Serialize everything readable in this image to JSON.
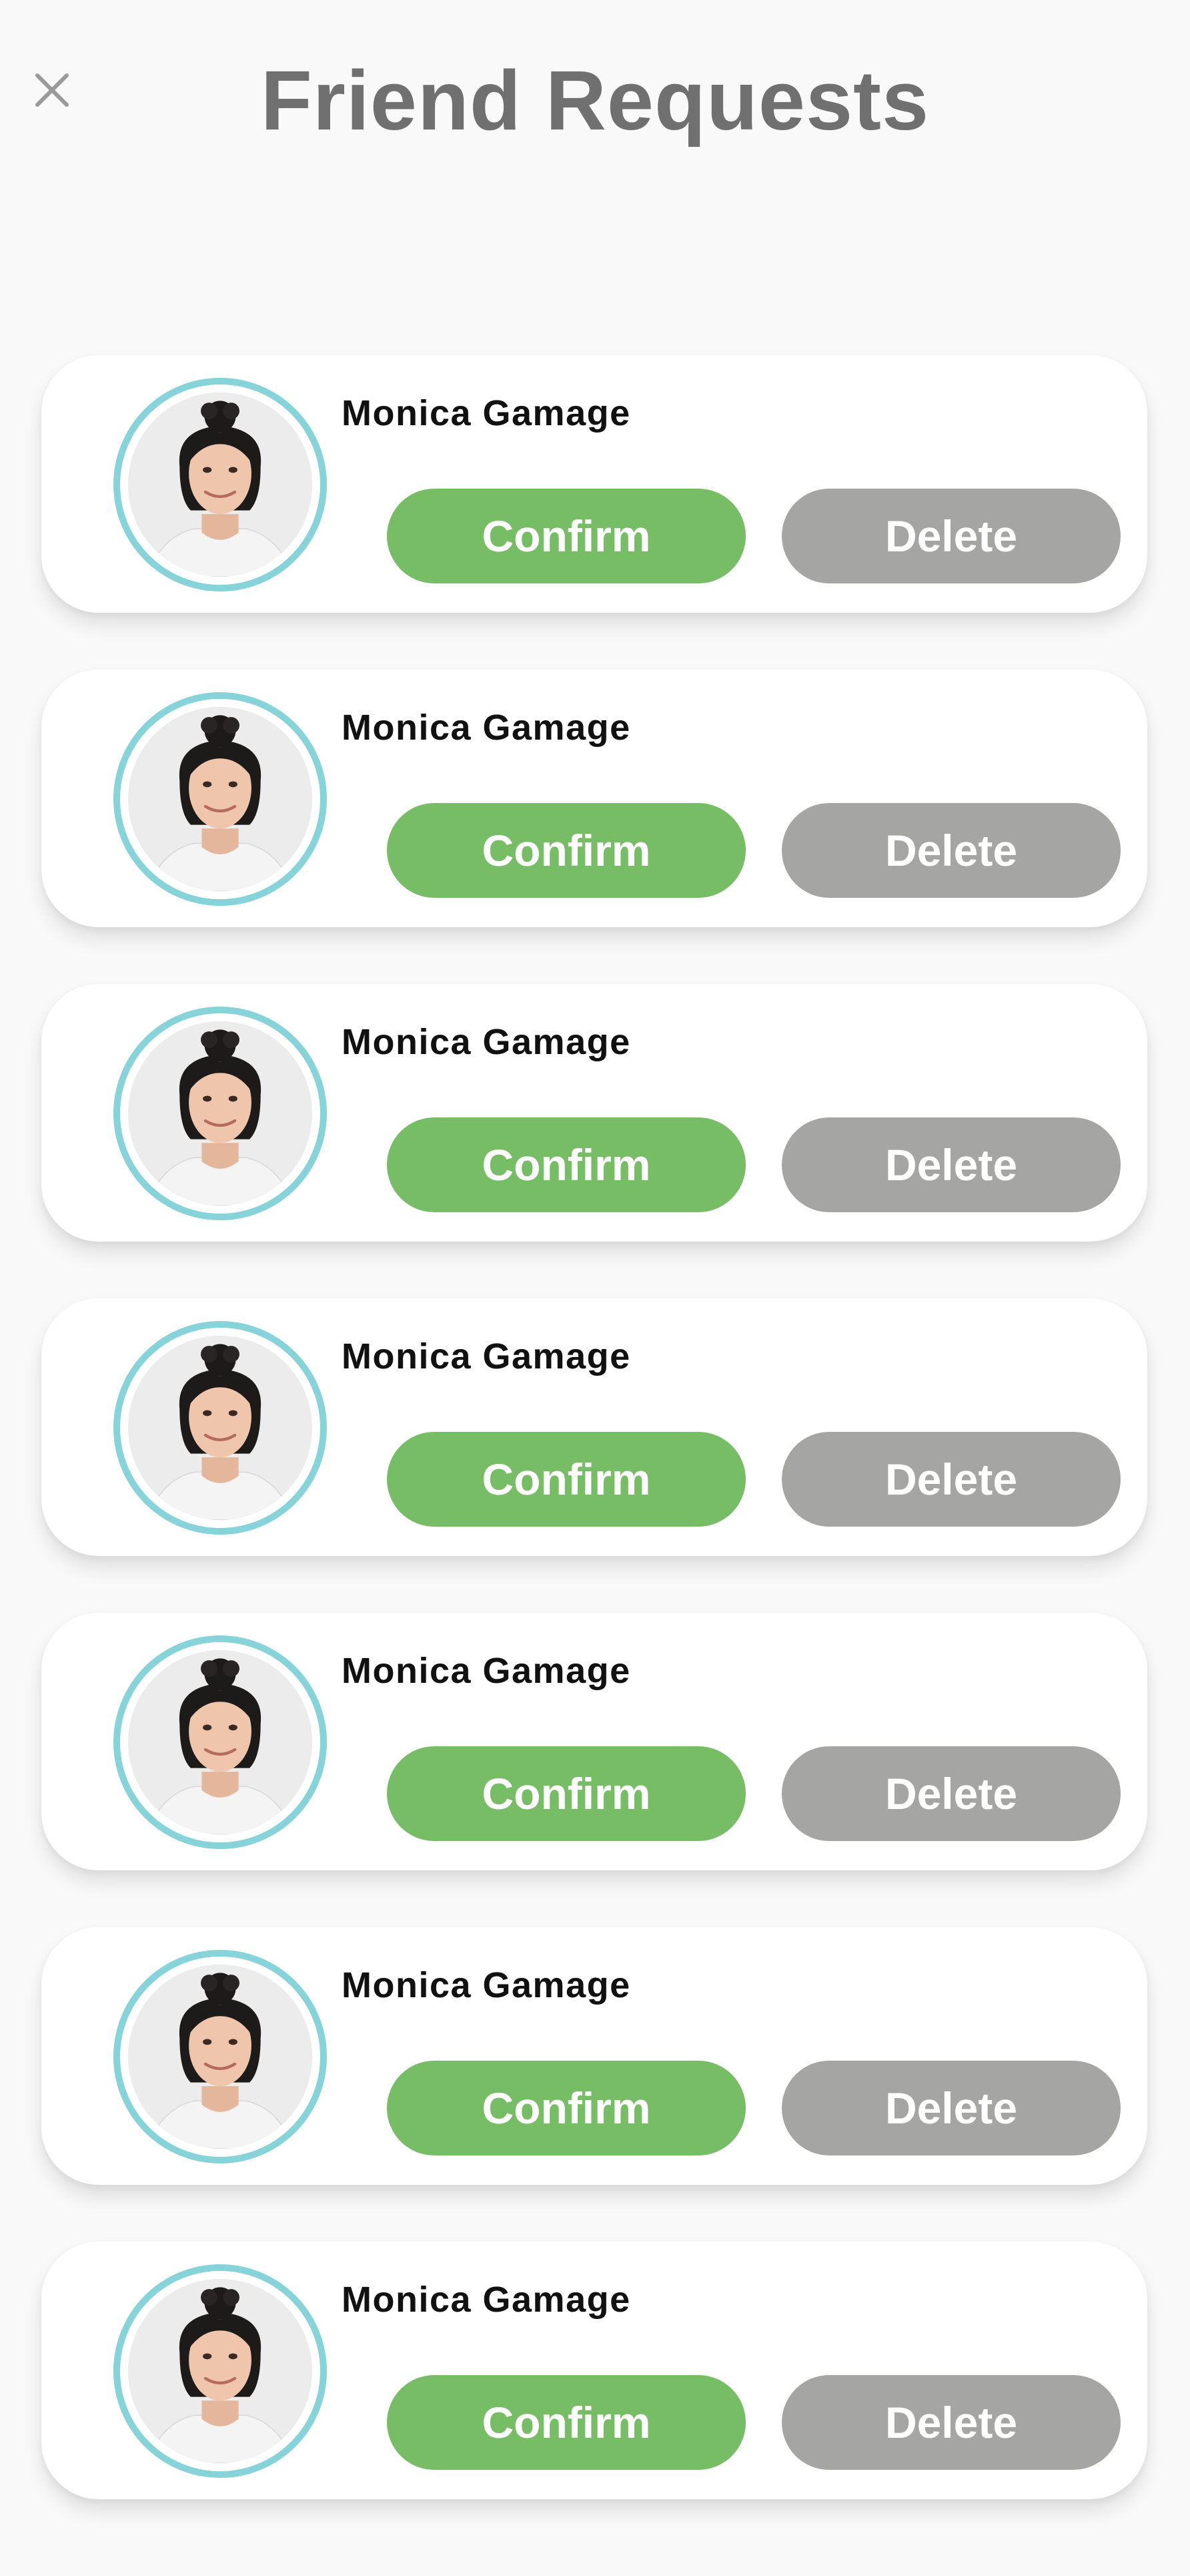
{
  "header": {
    "title": "Friend Requests",
    "close_icon": "close-icon"
  },
  "requests": [
    {
      "name": "Monica Gamage",
      "confirm_label": "Confirm",
      "delete_label": "Delete"
    },
    {
      "name": "Monica Gamage",
      "confirm_label": "Confirm",
      "delete_label": "Delete"
    },
    {
      "name": "Monica Gamage",
      "confirm_label": "Confirm",
      "delete_label": "Delete"
    },
    {
      "name": "Monica Gamage",
      "confirm_label": "Confirm",
      "delete_label": "Delete"
    },
    {
      "name": "Monica Gamage",
      "confirm_label": "Confirm",
      "delete_label": "Delete"
    },
    {
      "name": "Monica Gamage",
      "confirm_label": "Confirm",
      "delete_label": "Delete"
    },
    {
      "name": "Monica Gamage",
      "confirm_label": "Confirm",
      "delete_label": "Delete"
    }
  ],
  "colors": {
    "background": "#f9f9f9",
    "title": "#707070",
    "confirm": "#77bd66",
    "delete": "#a5a6a4",
    "avatar_ring": "#86d3da"
  }
}
